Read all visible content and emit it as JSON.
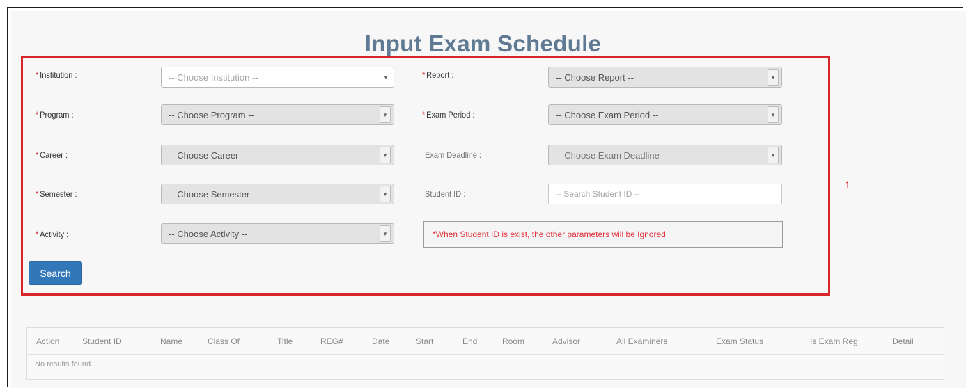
{
  "page": {
    "title": "Input Exam Schedule"
  },
  "form": {
    "left": [
      {
        "label": "Institution :",
        "required": "*",
        "placeholder": "-- Choose Institution --"
      },
      {
        "label": "Program :",
        "required": "*",
        "placeholder": "-- Choose Program --"
      },
      {
        "label": "Career :",
        "required": "*",
        "placeholder": "-- Choose Career --"
      },
      {
        "label": "Semester :",
        "required": "*",
        "placeholder": "-- Choose Semester --"
      },
      {
        "label": "Activity :",
        "required": "*",
        "placeholder": "-- Choose Activity --"
      }
    ],
    "right": [
      {
        "label": "Report :",
        "required": "*",
        "placeholder": "-- Choose Report --"
      },
      {
        "label": "Exam Period :",
        "required": "*",
        "placeholder": "-- Choose Exam Period --"
      },
      {
        "label": "Exam Deadline :",
        "placeholder": "-- Choose Exam Deadline --"
      },
      {
        "label": "Student ID :",
        "placeholder": "-- Search Student ID --"
      }
    ],
    "note": "*When Student ID is exist, the other parameters will be Ignored",
    "search_label": "Search",
    "caret": "▼"
  },
  "annotation": {
    "marker": "1"
  },
  "table": {
    "columns": [
      "Action",
      "Student ID",
      "Name",
      "Class Of",
      "Title",
      "REG#",
      "Date",
      "Start",
      "End",
      "Room",
      "Advisor",
      "All Examiners",
      "Exam Status",
      "Is Exam Reg",
      "Detail"
    ],
    "empty_text": "No results found."
  },
  "colors": {
    "title": "#5f7a92",
    "highlight_border": "#d8262d",
    "primary_button": "#3278b9",
    "warning_text": "#e0303a"
  }
}
